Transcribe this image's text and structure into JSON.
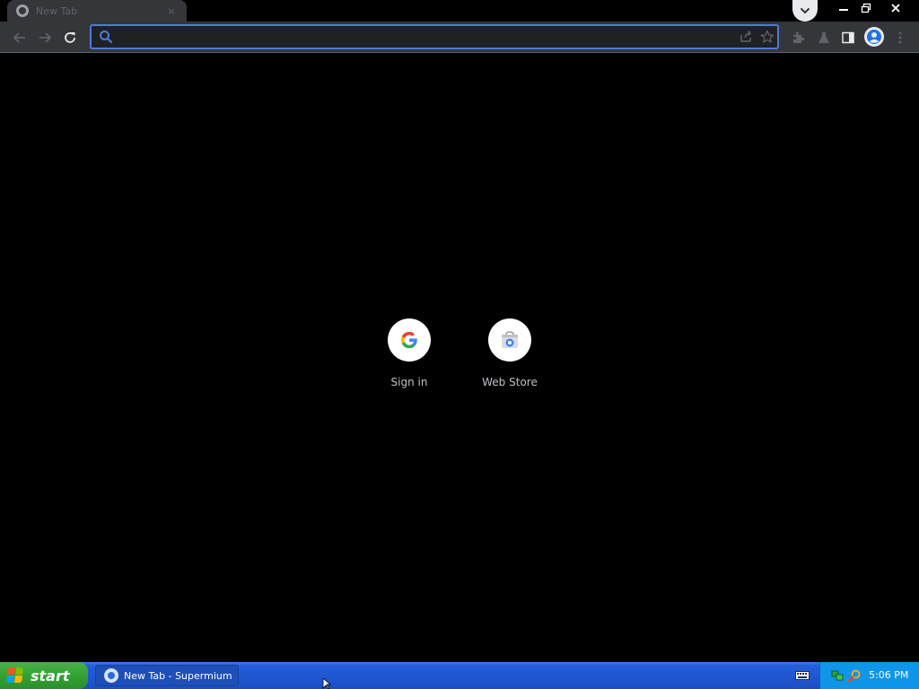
{
  "browser": {
    "tab": {
      "title": "New Tab",
      "close_glyph": "×",
      "favicon": "globe-icon"
    },
    "window_controls": {
      "minimize": "—",
      "restore": "❐",
      "close": "✕"
    },
    "omnibox": {
      "value": "",
      "placeholder": ""
    },
    "colors": {
      "toolbar": "#35363a",
      "omnibox_focus": "#4b7bdc",
      "page_background": "#000000"
    }
  },
  "new_tab_page": {
    "shortcuts": [
      {
        "label": "Sign in",
        "icon": "google-g-icon"
      },
      {
        "label": "Web Store",
        "icon": "chrome-web-store-icon"
      }
    ]
  },
  "taskbar": {
    "start_label": "start",
    "task_label": "New Tab - Supermium",
    "clock": "5:06 PM"
  }
}
